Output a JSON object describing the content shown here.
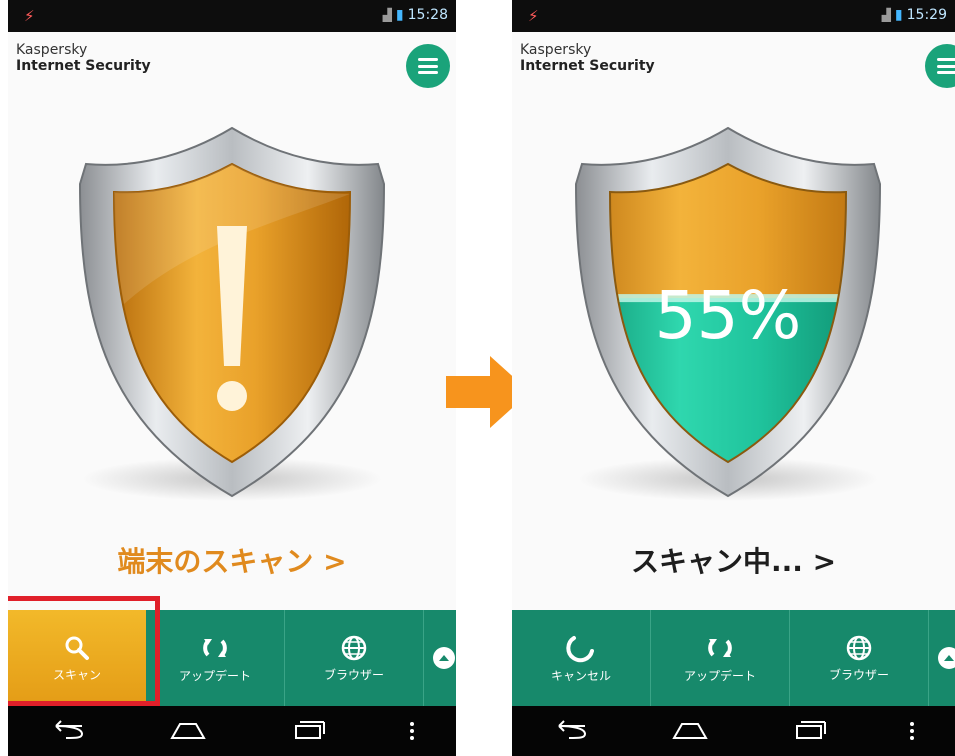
{
  "left_screen": {
    "status": {
      "time": "15:28"
    },
    "brand": {
      "line1": "Kaspersky",
      "line2": "Internet Security"
    },
    "status_text": "端末のスキャン >",
    "toolbar": [
      {
        "label": "スキャン",
        "icon": "search-icon",
        "selected": true
      },
      {
        "label": "アップデート",
        "icon": "update-icon",
        "selected": false
      },
      {
        "label": "ブラウザー",
        "icon": "globe-icon",
        "selected": false
      }
    ],
    "shield_state": "warning"
  },
  "right_screen": {
    "status": {
      "time": "15:29"
    },
    "brand": {
      "line1": "Kaspersky",
      "line2": "Internet Security"
    },
    "progress_label": "55%",
    "progress_value": 55,
    "status_text": "スキャン中... >",
    "toolbar": [
      {
        "label": "キャンセル",
        "icon": "cancel-spinner-icon"
      },
      {
        "label": "アップデート",
        "icon": "update-icon"
      },
      {
        "label": "ブラウザー",
        "icon": "globe-icon"
      }
    ]
  },
  "colors": {
    "accent_green": "#17896b",
    "shield_orange": "#e59a1c",
    "shield_teal": "#1fc39c",
    "arrow_orange": "#f7941d",
    "highlight_red": "#e0202a"
  }
}
